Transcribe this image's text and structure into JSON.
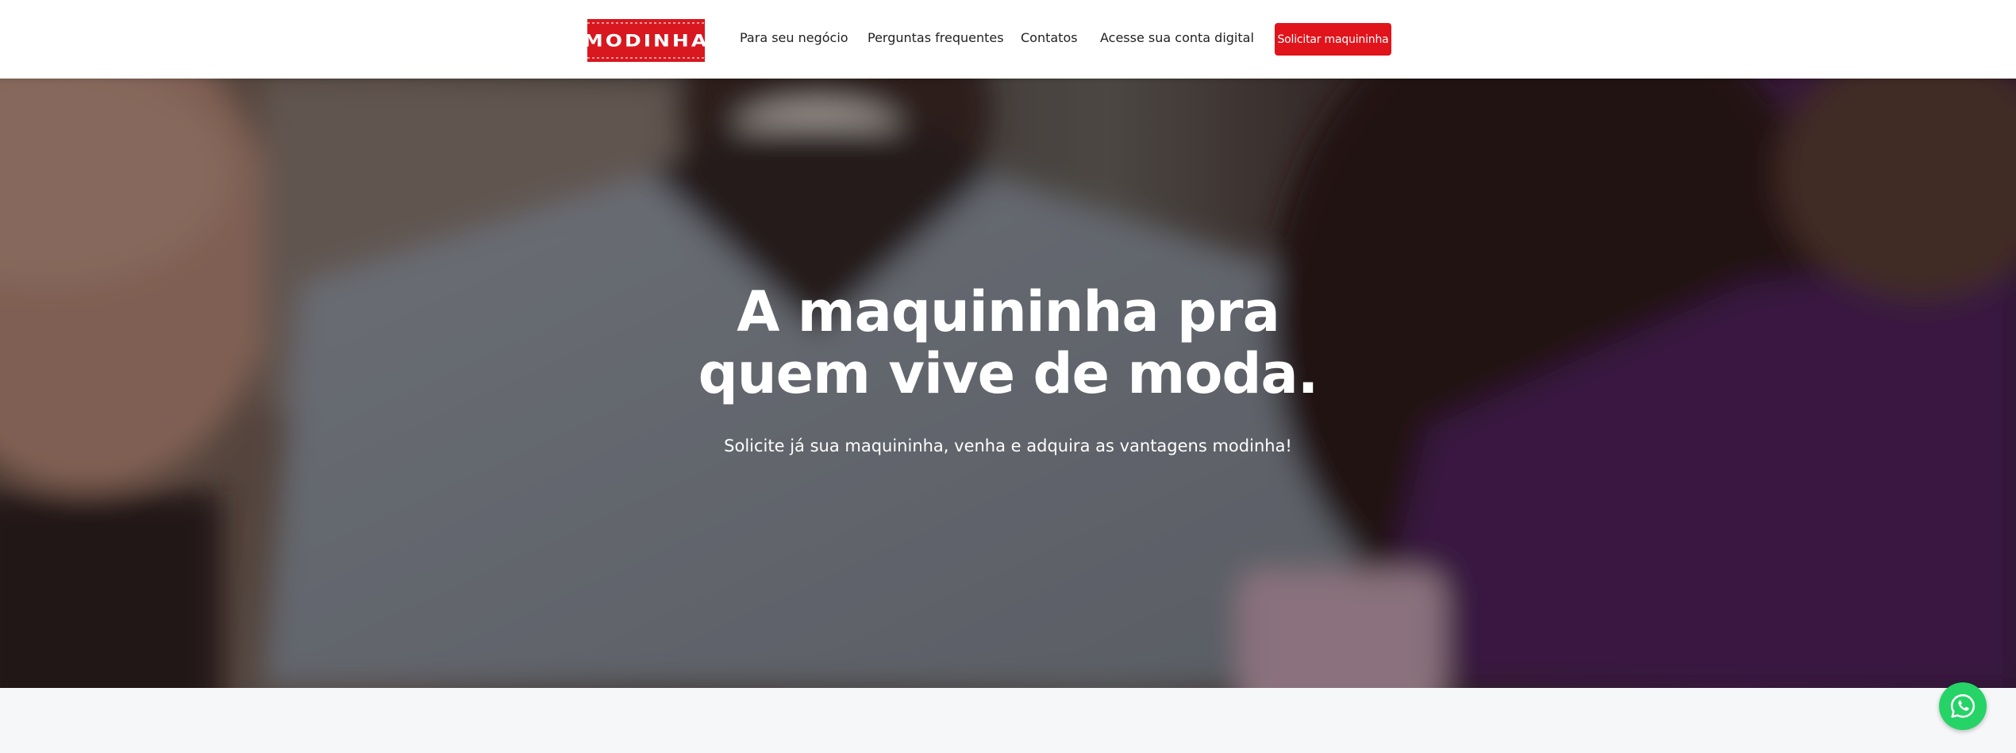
{
  "header": {
    "logo_text": "MODINHA",
    "nav": [
      {
        "label": "Para seu negócio"
      },
      {
        "label": "Perguntas frequentes"
      },
      {
        "label": "Contatos"
      },
      {
        "label": "Acesse sua conta digital"
      }
    ],
    "cta_label": "Solicitar maquininha"
  },
  "hero": {
    "title_line1": "A maquininha pra",
    "title_line2": "quem vive de moda.",
    "subtitle": "Solicite já sua maquininha, venha e adquira as vantagens modinha!"
  },
  "floating": {
    "whatsapp_icon": "whatsapp-icon"
  },
  "colors": {
    "brand_red": "#e1141c",
    "whatsapp_green": "#25d366",
    "section_bg": "#f6f7f9"
  }
}
